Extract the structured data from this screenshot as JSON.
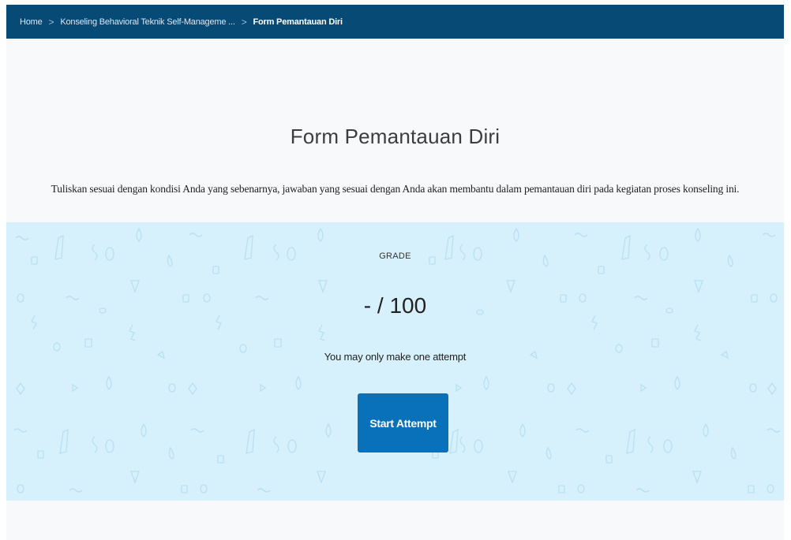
{
  "breadcrumb": {
    "items": [
      "Home",
      "Konseling Behavioral Teknik Self-Manageme ..."
    ],
    "current": "Form Pemantauan Diri",
    "separator": ">"
  },
  "page": {
    "title": "Form Pemantauan Diri",
    "description": "Tuliskan sesuai dengan kondisi Anda yang sebenarnya, jawaban yang sesuai dengan Anda akan membantu dalam pemantauan diri pada kegiatan proses konseling ini."
  },
  "grade": {
    "label": "GRADE",
    "value": "- / 100",
    "attempt_note": "You may only make one attempt",
    "start_button": "Start Attempt"
  },
  "colors": {
    "topbar": "#074a76",
    "panel": "#d6f0fc",
    "button": "#0871b9",
    "pattern": "#b6def3"
  }
}
